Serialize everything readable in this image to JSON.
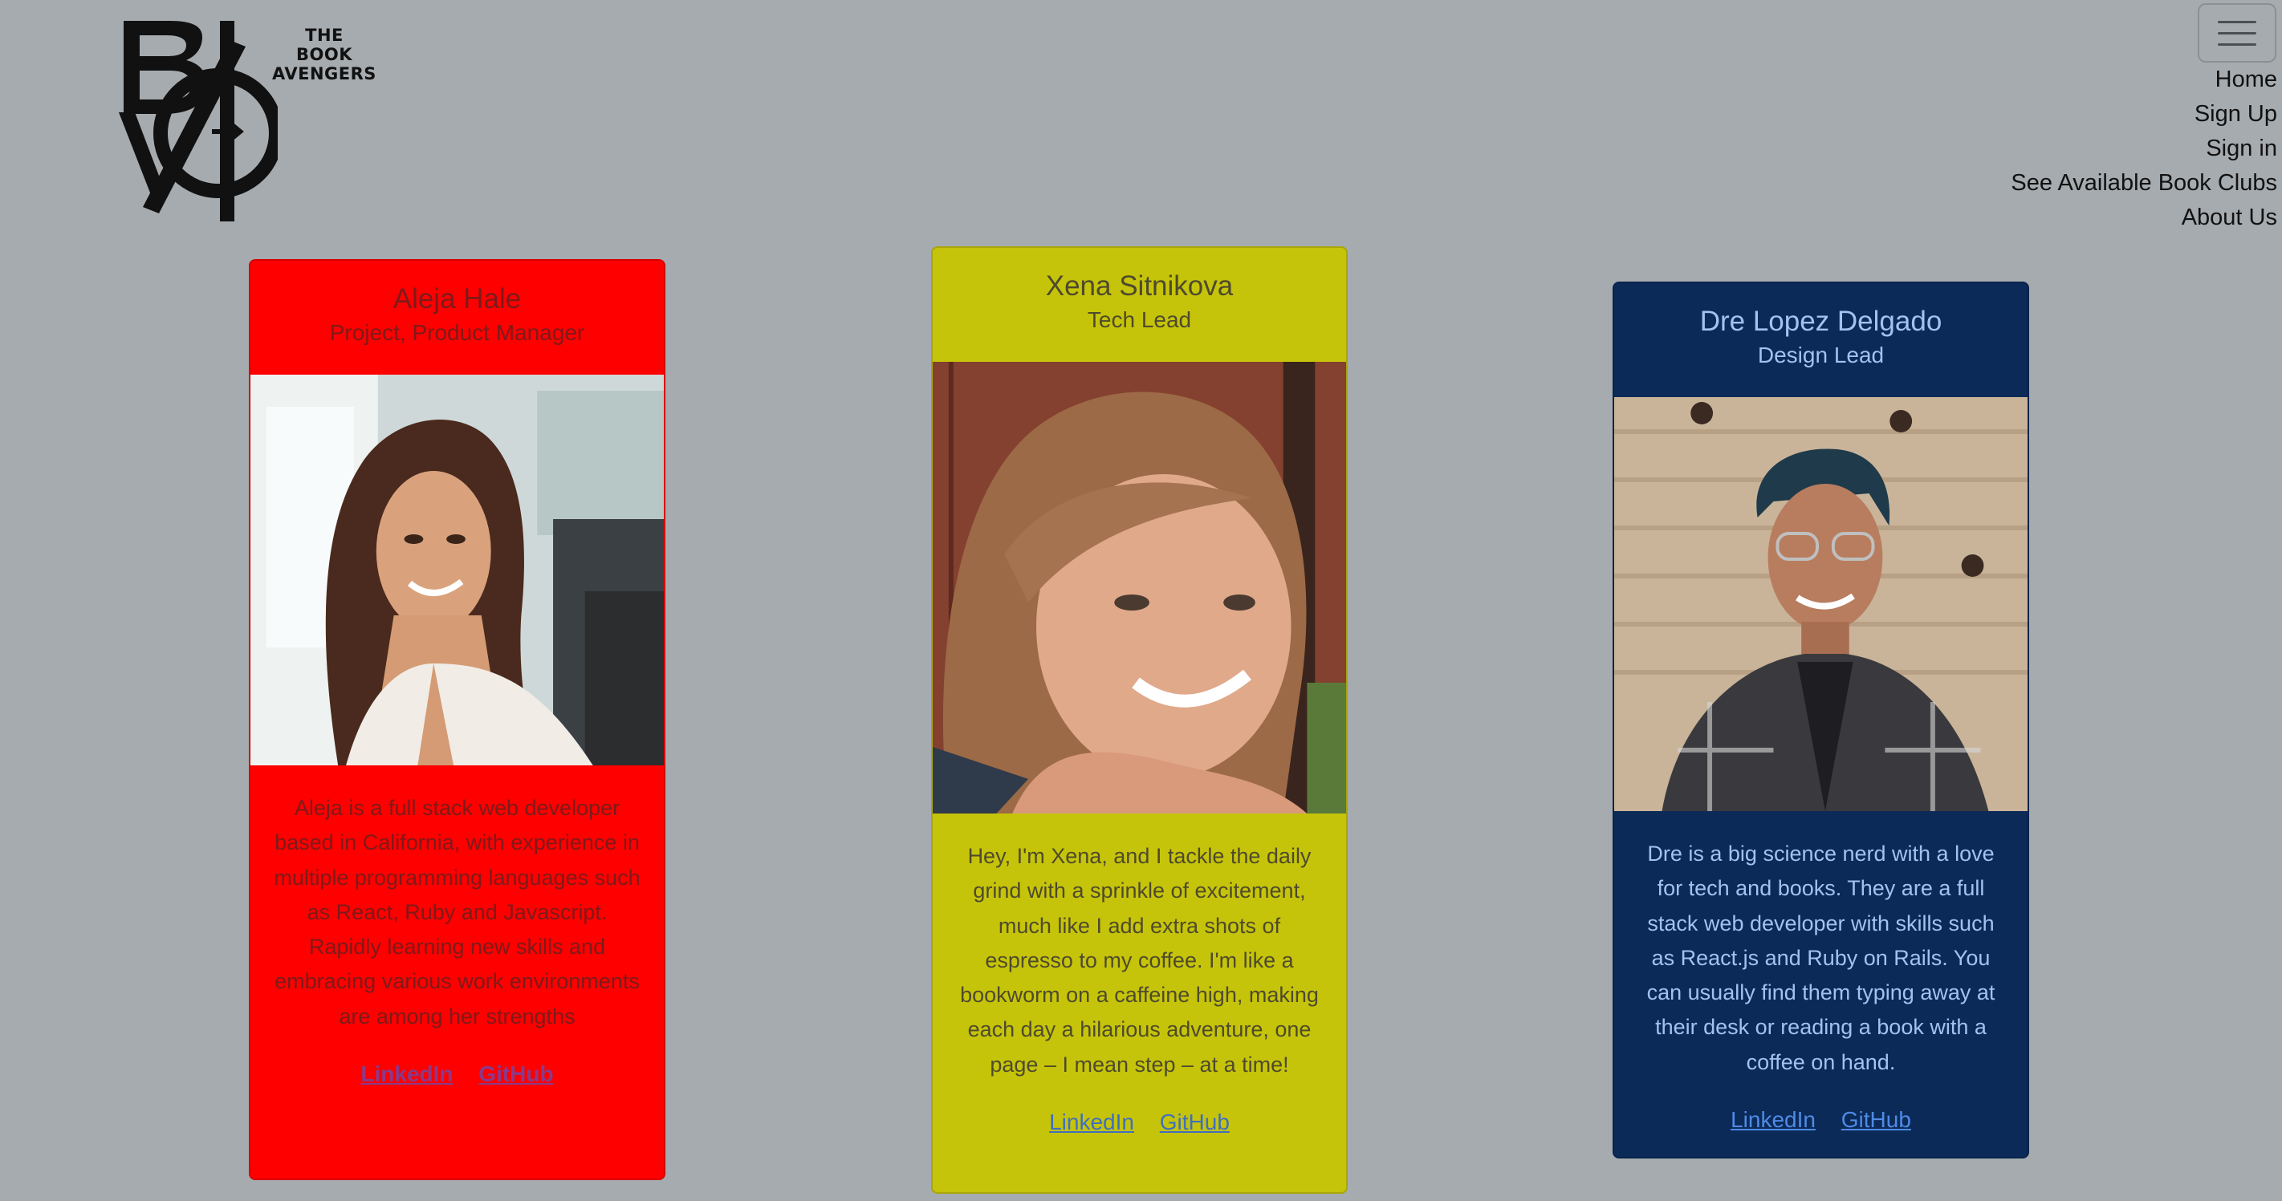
{
  "brand": {
    "logo_lines": [
      "THE",
      "BOOK",
      "AVENGERS"
    ]
  },
  "nav": {
    "toggler_icon": "hamburger-icon",
    "items": [
      "Home",
      "Sign Up",
      "Sign in",
      "See Available Book Clubs",
      "About Us"
    ]
  },
  "team": [
    {
      "name": "Aleja Hale",
      "role": "Project, Product Manager",
      "bio": "Aleja is a full stack web developer based in California, with experience in multiple programming languages such as React, Ruby and Javascript. Rapidly learning new skills and embracing various work environments are among her strengths",
      "links": [
        "LinkedIn",
        "GitHub"
      ],
      "card_color": "#fe0000"
    },
    {
      "name": "Xena Sitnikova",
      "role": "Tech Lead",
      "bio": "Hey, I'm Xena, and I tackle the daily grind with a sprinkle of excitement, much like I add extra shots of espresso to my coffee. I'm like a bookworm on a caffeine high, making each day a hilarious adventure, one page – I mean step – at a time!",
      "links": [
        "LinkedIn",
        "GitHub"
      ],
      "card_color": "#c6c40a"
    },
    {
      "name": "Dre Lopez Delgado",
      "role": "Design Lead",
      "bio": "Dre is a big science nerd with a love for tech and books. They are a full stack web developer with skills such as React.js and Ruby on Rails. You can usually find them typing away at their desk or reading a book with a coffee on hand.",
      "links": [
        "LinkedIn",
        "GitHub"
      ],
      "card_color": "#0b2a57"
    }
  ]
}
